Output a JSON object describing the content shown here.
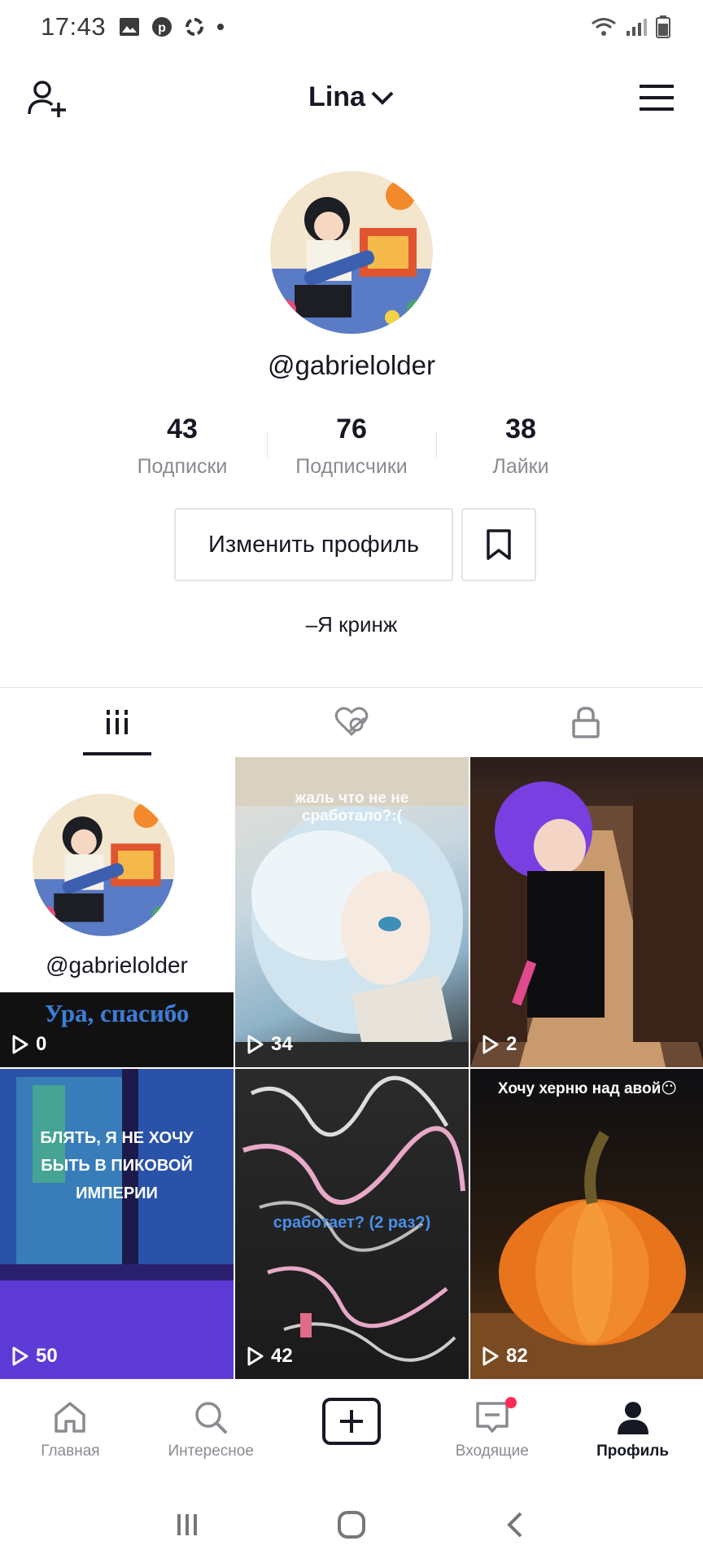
{
  "status_bar": {
    "time": "17:43"
  },
  "header": {
    "title": "Lina"
  },
  "profile": {
    "username": "@gabrielolder",
    "stats": [
      {
        "value": "43",
        "label": "Подписки"
      },
      {
        "value": "76",
        "label": "Подписчики"
      },
      {
        "value": "38",
        "label": "Лайки"
      }
    ],
    "edit_label": "Изменить профиль",
    "bio": "–Я кринж"
  },
  "tabs": [
    "videos-grid-icon",
    "liked-hidden-icon",
    "lock-icon"
  ],
  "videos": [
    {
      "views": "0",
      "caption": "Ура, спасибо",
      "name": "@gabrielolder"
    },
    {
      "views": "34",
      "caption": "жаль что не не сработало?:("
    },
    {
      "views": "2",
      "caption": ""
    },
    {
      "views": "50",
      "caption": "БЛЯТЬ, Я НЕ ХОЧУ БЫТЬ В ПИКОВОЙ ИМПЕРИИ"
    },
    {
      "views": "42",
      "caption": "сработает? (2 раз?)"
    },
    {
      "views": "82",
      "caption": "Хочу херню над авой😶"
    }
  ],
  "bottom_nav": [
    {
      "label": "Главная",
      "icon": "home-icon"
    },
    {
      "label": "Интересное",
      "icon": "search-icon"
    },
    {
      "label": "",
      "icon": "create-icon"
    },
    {
      "label": "Входящие",
      "icon": "inbox-icon"
    },
    {
      "label": "Профиль",
      "icon": "profile-icon"
    }
  ],
  "colors": {
    "accent": "#fe2c55",
    "text": "#161823",
    "muted": "#8a8b91"
  }
}
